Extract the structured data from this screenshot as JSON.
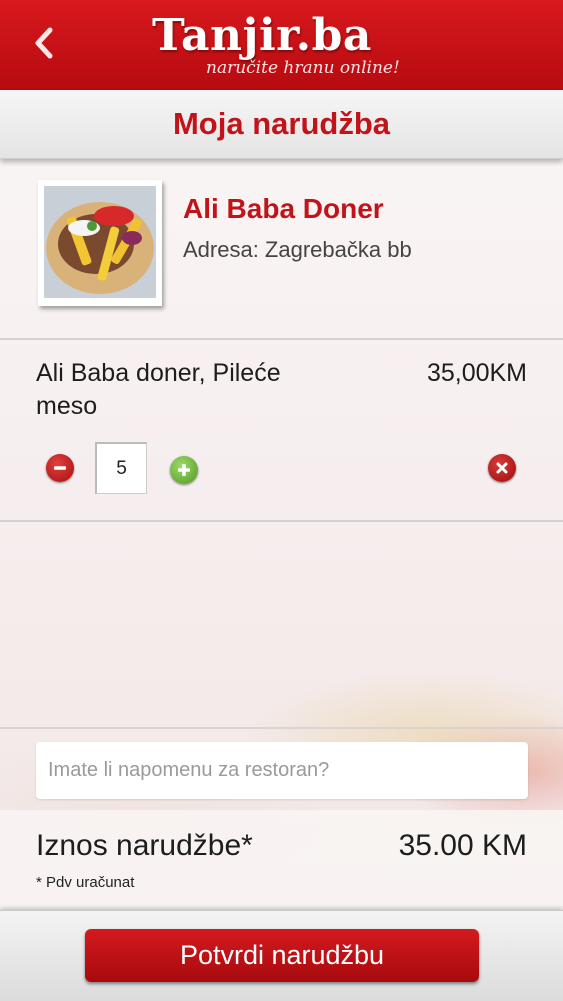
{
  "header": {
    "logo_text": "Tanjir.ba",
    "tagline": "naručite hranu online!",
    "back_icon": "chevron-left-icon"
  },
  "page": {
    "title": "Moja narudžba"
  },
  "restaurant": {
    "name": "Ali Baba Doner",
    "address": "Adresa: Zagrebačka bb"
  },
  "order_item": {
    "name": "Ali Baba doner, Pileće meso",
    "price": "35,00KM",
    "quantity": "5",
    "decrease_icon": "minus-circle-icon",
    "increase_icon": "plus-circle-icon",
    "remove_icon": "close-circle-icon"
  },
  "note": {
    "placeholder": "Imate li napomenu za restoran?",
    "value": ""
  },
  "total": {
    "label": "Iznos narudžbe*",
    "value": "35.00 KM",
    "vat_note": "* Pdv uračunat"
  },
  "footer": {
    "confirm_label": "Potvrdi narudžbu"
  },
  "colors": {
    "brand_red": "#c0141a",
    "header_red": "#c8121a",
    "increase_green": "#5aa42a"
  }
}
